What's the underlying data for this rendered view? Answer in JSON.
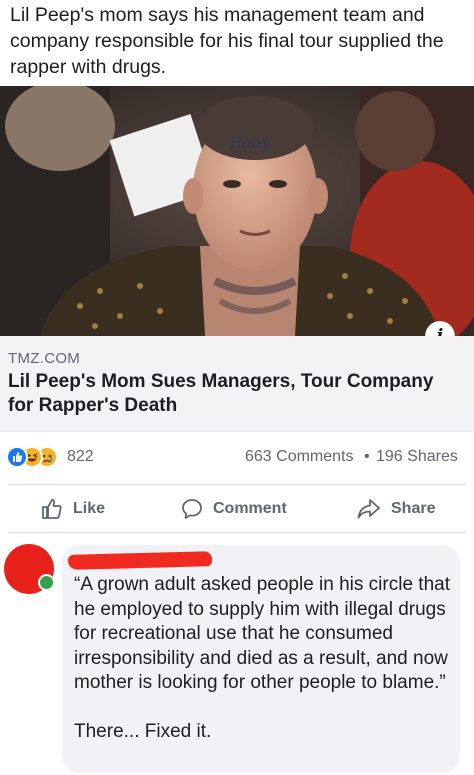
{
  "post": {
    "text": "Lil Peep's mom says his management team and company responsible for his final tour supplied the rapper with drugs."
  },
  "link": {
    "domain": "TMZ.COM",
    "title": "Lil Peep's Mom Sues Managers, Tour Company for Rapper's Death",
    "info_icon": "info-icon",
    "info_glyph": "i"
  },
  "stats": {
    "reactions": [
      "like",
      "haha",
      "sad"
    ],
    "reaction_count": "822",
    "comments": "663 Comments",
    "separator": "•",
    "shares": "196 Shares"
  },
  "actions": {
    "like_label": "Like",
    "comment_label": "Comment",
    "share_label": "Share"
  },
  "comment": {
    "text": "“A grown adult asked people in his circle that he employed to supply him with illegal drugs for recreational use that he consumed irresponsibility and died as a result, and now mother is looking for other people to blame.”\n\nThere... Fixed it."
  },
  "colors": {
    "accent": "#1877f2",
    "secondary_text": "#606770",
    "caption_bg": "#f2f3f5",
    "bubble_bg": "#f0f2f5",
    "redaction": "#f02a1f",
    "online": "#31a24c"
  }
}
